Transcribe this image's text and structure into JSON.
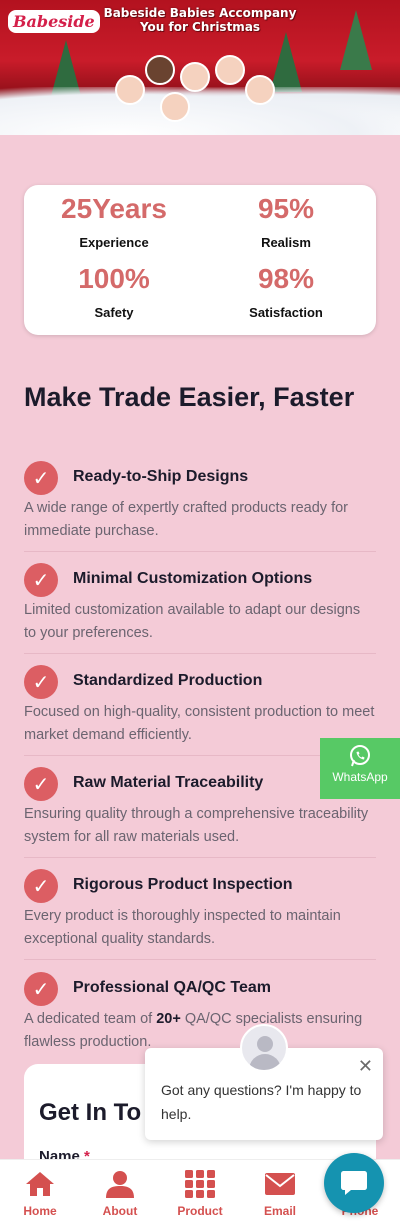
{
  "banner": {
    "logo_text": "Babeside",
    "title_line1": "Babeside Babies Accompany",
    "title_line2": "You for Christmas"
  },
  "stats": [
    {
      "value": "25Years",
      "label": "Experience"
    },
    {
      "value": "95%",
      "label": "Realism"
    },
    {
      "value": "100%",
      "label": "Safety"
    },
    {
      "value": "98%",
      "label": "Satisfaction"
    }
  ],
  "section": {
    "heading": "Make Trade Easier, Faster",
    "features": [
      {
        "title": "Ready-to-Ship Designs",
        "desc": "A wide range of expertly crafted products ready for immediate purchase."
      },
      {
        "title": "Minimal Customization Options",
        "desc": "Limited customization available to adapt our designs to your preferences."
      },
      {
        "title": "Standardized Production",
        "desc": "Focused on high-quality, consistent production to meet market demand efficiently."
      },
      {
        "title": "Raw Material Traceability",
        "desc": "Ensuring quality through a comprehensive traceability system for all raw materials used."
      },
      {
        "title": "Rigorous Product Inspection",
        "desc": "Every product is thoroughly inspected to maintain exceptional quality standards."
      },
      {
        "title": "Professional QA/QC Team",
        "desc_pre": "A dedicated team of ",
        "desc_bold": "20+",
        "desc_post": " QA/QC specialists ensuring flawless production."
      }
    ]
  },
  "whatsapp": {
    "label": "WhatsApp",
    "icon": "whatsapp-icon"
  },
  "contact": {
    "title": "Get In To",
    "name_label": "Name",
    "required_mark": "*"
  },
  "chat": {
    "message": "Got any questions? I'm happy to help.",
    "close": "✕",
    "avatar_icon": "user-avatar-icon"
  },
  "nav": [
    {
      "label": "Home",
      "icon": "home-icon"
    },
    {
      "label": "About",
      "icon": "user-icon"
    },
    {
      "label": "Product",
      "icon": "grid-icon"
    },
    {
      "label": "Email",
      "icon": "mail-icon"
    },
    {
      "label": "Phone",
      "icon": "phone-icon"
    }
  ],
  "colors": {
    "accent": "#d46a6a",
    "nav_accent": "#d4504f",
    "background": "#f4cbd7",
    "whatsapp": "#57c965",
    "chat_fab": "#1593b0"
  }
}
